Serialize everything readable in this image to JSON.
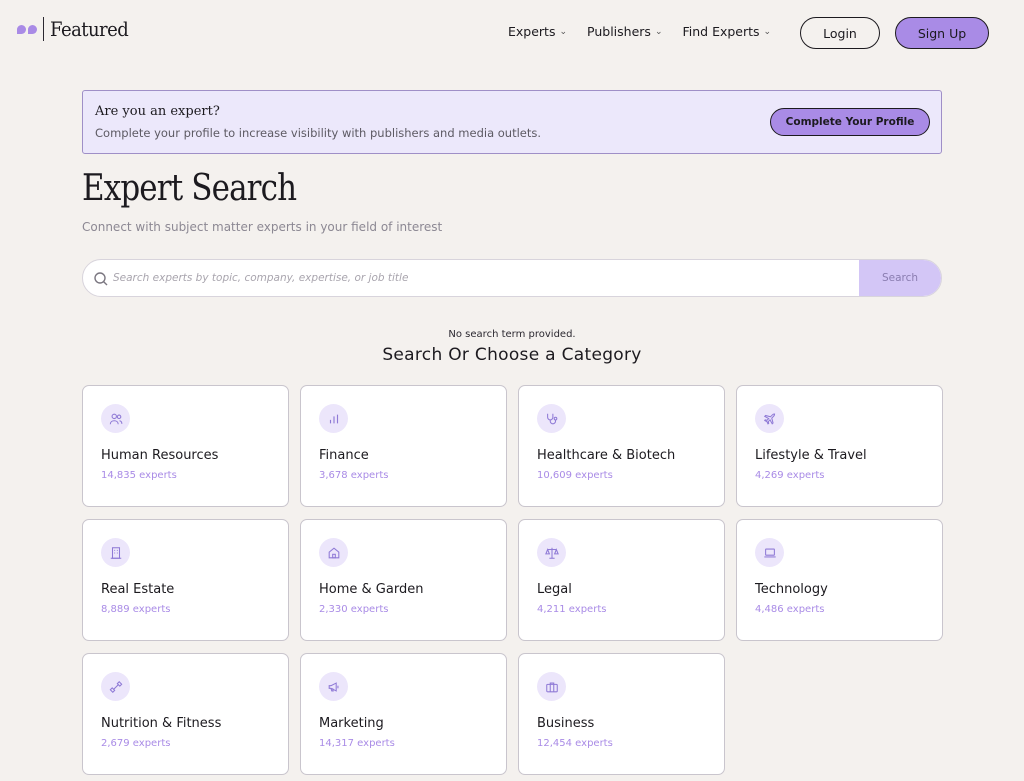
{
  "brand": {
    "name": "Featured",
    "accent": "#a98be6"
  },
  "nav": {
    "items": [
      {
        "label": "Experts"
      },
      {
        "label": "Publishers"
      },
      {
        "label": "Find Experts"
      }
    ],
    "login_label": "Login",
    "signup_label": "Sign Up"
  },
  "banner": {
    "title": "Are you an expert?",
    "subtitle": "Complete your profile to increase visibility with publishers and media outlets.",
    "button_label": "Complete Your Profile"
  },
  "page": {
    "title": "Expert Search",
    "subtitle": "Connect with subject matter experts in your field of interest"
  },
  "search": {
    "placeholder": "Search experts by topic, company, expertise, or job title",
    "value": "",
    "button_label": "Search"
  },
  "status": {
    "message": "No search term provided.",
    "heading": "Search Or Choose a Category"
  },
  "categories": [
    {
      "name": "Human Resources",
      "count": "14,835 experts",
      "icon": "users-icon"
    },
    {
      "name": "Finance",
      "count": "3,678 experts",
      "icon": "bar-chart-icon"
    },
    {
      "name": "Healthcare & Biotech",
      "count": "10,609 experts",
      "icon": "stethoscope-icon"
    },
    {
      "name": "Lifestyle & Travel",
      "count": "4,269 experts",
      "icon": "plane-icon"
    },
    {
      "name": "Real Estate",
      "count": "8,889 experts",
      "icon": "building-icon"
    },
    {
      "name": "Home & Garden",
      "count": "2,330 experts",
      "icon": "home-icon"
    },
    {
      "name": "Legal",
      "count": "4,211 experts",
      "icon": "scale-icon"
    },
    {
      "name": "Technology",
      "count": "4,486 experts",
      "icon": "laptop-icon"
    },
    {
      "name": "Nutrition & Fitness",
      "count": "2,679 experts",
      "icon": "dumbbell-icon"
    },
    {
      "name": "Marketing",
      "count": "14,317 experts",
      "icon": "megaphone-icon"
    },
    {
      "name": "Business",
      "count": "12,454 experts",
      "icon": "briefcase-icon"
    }
  ]
}
